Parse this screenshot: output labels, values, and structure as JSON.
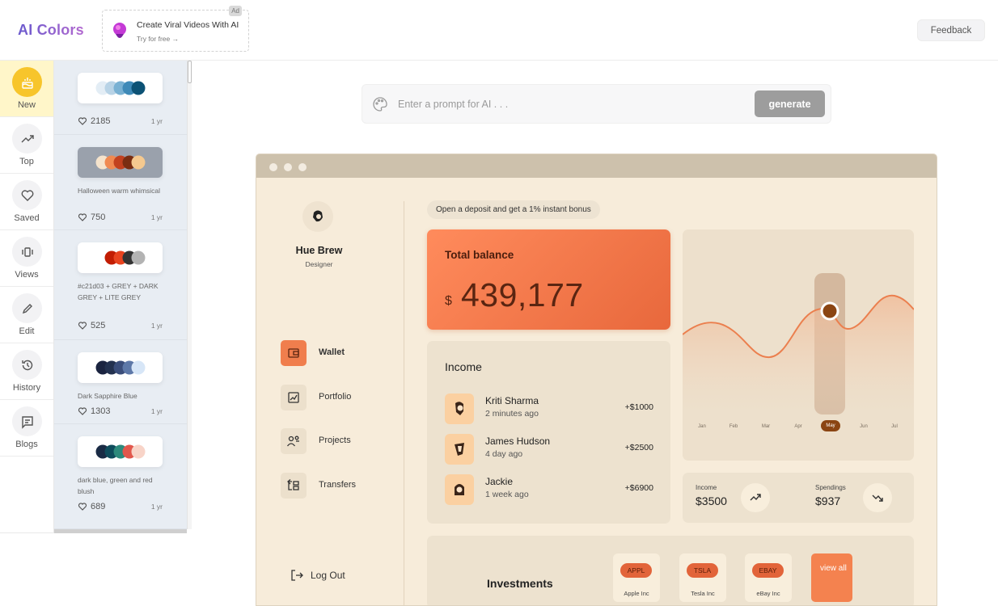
{
  "app": {
    "logo": "AI Colors",
    "feedback_label": "Feedback"
  },
  "ad": {
    "tag": "Ad",
    "title": "Create Viral Videos With AI",
    "subtitle": "Try for free →"
  },
  "nav": [
    {
      "label": "New",
      "icon": "cake-icon",
      "active": true
    },
    {
      "label": "Top",
      "icon": "trending-up-icon"
    },
    {
      "label": "Saved",
      "icon": "heart-icon"
    },
    {
      "label": "Views",
      "icon": "views-icon"
    },
    {
      "label": "Edit",
      "icon": "pencil-icon"
    },
    {
      "label": "History",
      "icon": "history-icon"
    },
    {
      "label": "Blogs",
      "icon": "blog-icon"
    }
  ],
  "palettes": [
    {
      "name": "",
      "likes": "2185",
      "age": "1 yr",
      "colors": [
        "#e3edf5",
        "#b8d3e6",
        "#79b1d3",
        "#3f8ab8",
        "#0c5275"
      ]
    },
    {
      "name": "Halloween warm whimsical",
      "likes": "750",
      "age": "1 yr",
      "colors": [
        "#f5e3cc",
        "#f08a52",
        "#c2411f",
        "#7a2d11",
        "#f5c98f"
      ]
    },
    {
      "name": "#c21d03 + GREY + DARK GREY + LITE GREY",
      "likes": "525",
      "age": "1 yr",
      "colors": [
        "#ffffff",
        "#c21d03",
        "#e8431f",
        "#333333",
        "#b3b3b3"
      ]
    },
    {
      "name": "Dark Sapphire Blue",
      "likes": "1303",
      "age": "1 yr",
      "colors": [
        "#1b2440",
        "#23314f",
        "#3a4d7a",
        "#5d78a8",
        "#d7e6f7"
      ]
    },
    {
      "name": "dark blue, green and red blush",
      "likes": "689",
      "age": "1 yr",
      "colors": [
        "#1a2b45",
        "#0f4c5c",
        "#2d8a7c",
        "#e2574c",
        "#f8d4c8"
      ]
    }
  ],
  "prompt": {
    "placeholder": "Enter a prompt for AI . . .",
    "generate_label": "generate"
  },
  "mock": {
    "user": {
      "name": "Hue Brew",
      "role": "Designer"
    },
    "menu": [
      {
        "label": "Wallet",
        "icon": "wallet-icon",
        "active": true
      },
      {
        "label": "Portfolio",
        "icon": "chart-icon"
      },
      {
        "label": "Projects",
        "icon": "people-icon"
      },
      {
        "label": "Transfers",
        "icon": "transfer-icon"
      }
    ],
    "logout_label": "Log Out",
    "banner": "Open a deposit and get a 1% instant bonus",
    "balance": {
      "label": "Total balance",
      "currency": "$",
      "value": "439,177"
    },
    "income": {
      "title": "Income",
      "rows": [
        {
          "name": "Kriti Sharma",
          "time": "2 minutes ago",
          "amount": "+$1000"
        },
        {
          "name": "James Hudson",
          "time": "4 day ago",
          "amount": "+$2500"
        },
        {
          "name": "Jackie",
          "time": "1 week ago",
          "amount": "+$6900"
        }
      ]
    },
    "chart_months": [
      "Jan",
      "Feb",
      "Mar",
      "Apr",
      "May",
      "Jun",
      "Jul"
    ],
    "chart_selected": "May",
    "stats": {
      "income_label": "Income",
      "income_value": "$3500",
      "spend_label": "Spendings",
      "spend_value": "$937"
    },
    "investments": {
      "title": "Investments",
      "stocks": [
        {
          "ticker": "APPL",
          "name": "Apple Inc"
        },
        {
          "ticker": "TSLA",
          "name": "Tesla Inc"
        },
        {
          "ticker": "EBAY",
          "name": "eBay Inc"
        }
      ],
      "view_all": "view all"
    }
  },
  "colors": {
    "accent": "#f07e4d",
    "nav_active_bg": "#fff6c9",
    "nav_active_icon": "#f7c52b",
    "generate_bg": "#9d9d9d"
  }
}
